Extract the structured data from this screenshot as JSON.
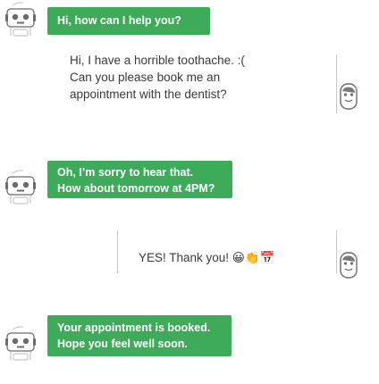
{
  "colors": {
    "bot_bubble": "#3dab5a",
    "bot_text": "#ffffff",
    "user_text": "#3a3a3a"
  },
  "messages": [
    {
      "sender": "bot",
      "lines": [
        "Hi, how can I help you?"
      ]
    },
    {
      "sender": "user",
      "lines": [
        "Hi, I have a horrible toothache. :(",
        "Can you please book me an",
        "appointment with the dentist?"
      ]
    },
    {
      "sender": "bot",
      "lines": [
        "Oh, I’m sorry to hear that.",
        "How about tomorrow at 4PM?"
      ]
    },
    {
      "sender": "user",
      "lines": [
        "YES! Thank you! 😀👏📅"
      ]
    },
    {
      "sender": "bot",
      "lines": [
        "Your appointment is booked.",
        "Hope you feel well soon."
      ]
    }
  ],
  "icons": {
    "bot": "robot-icon",
    "user": "user-avatar-icon"
  }
}
